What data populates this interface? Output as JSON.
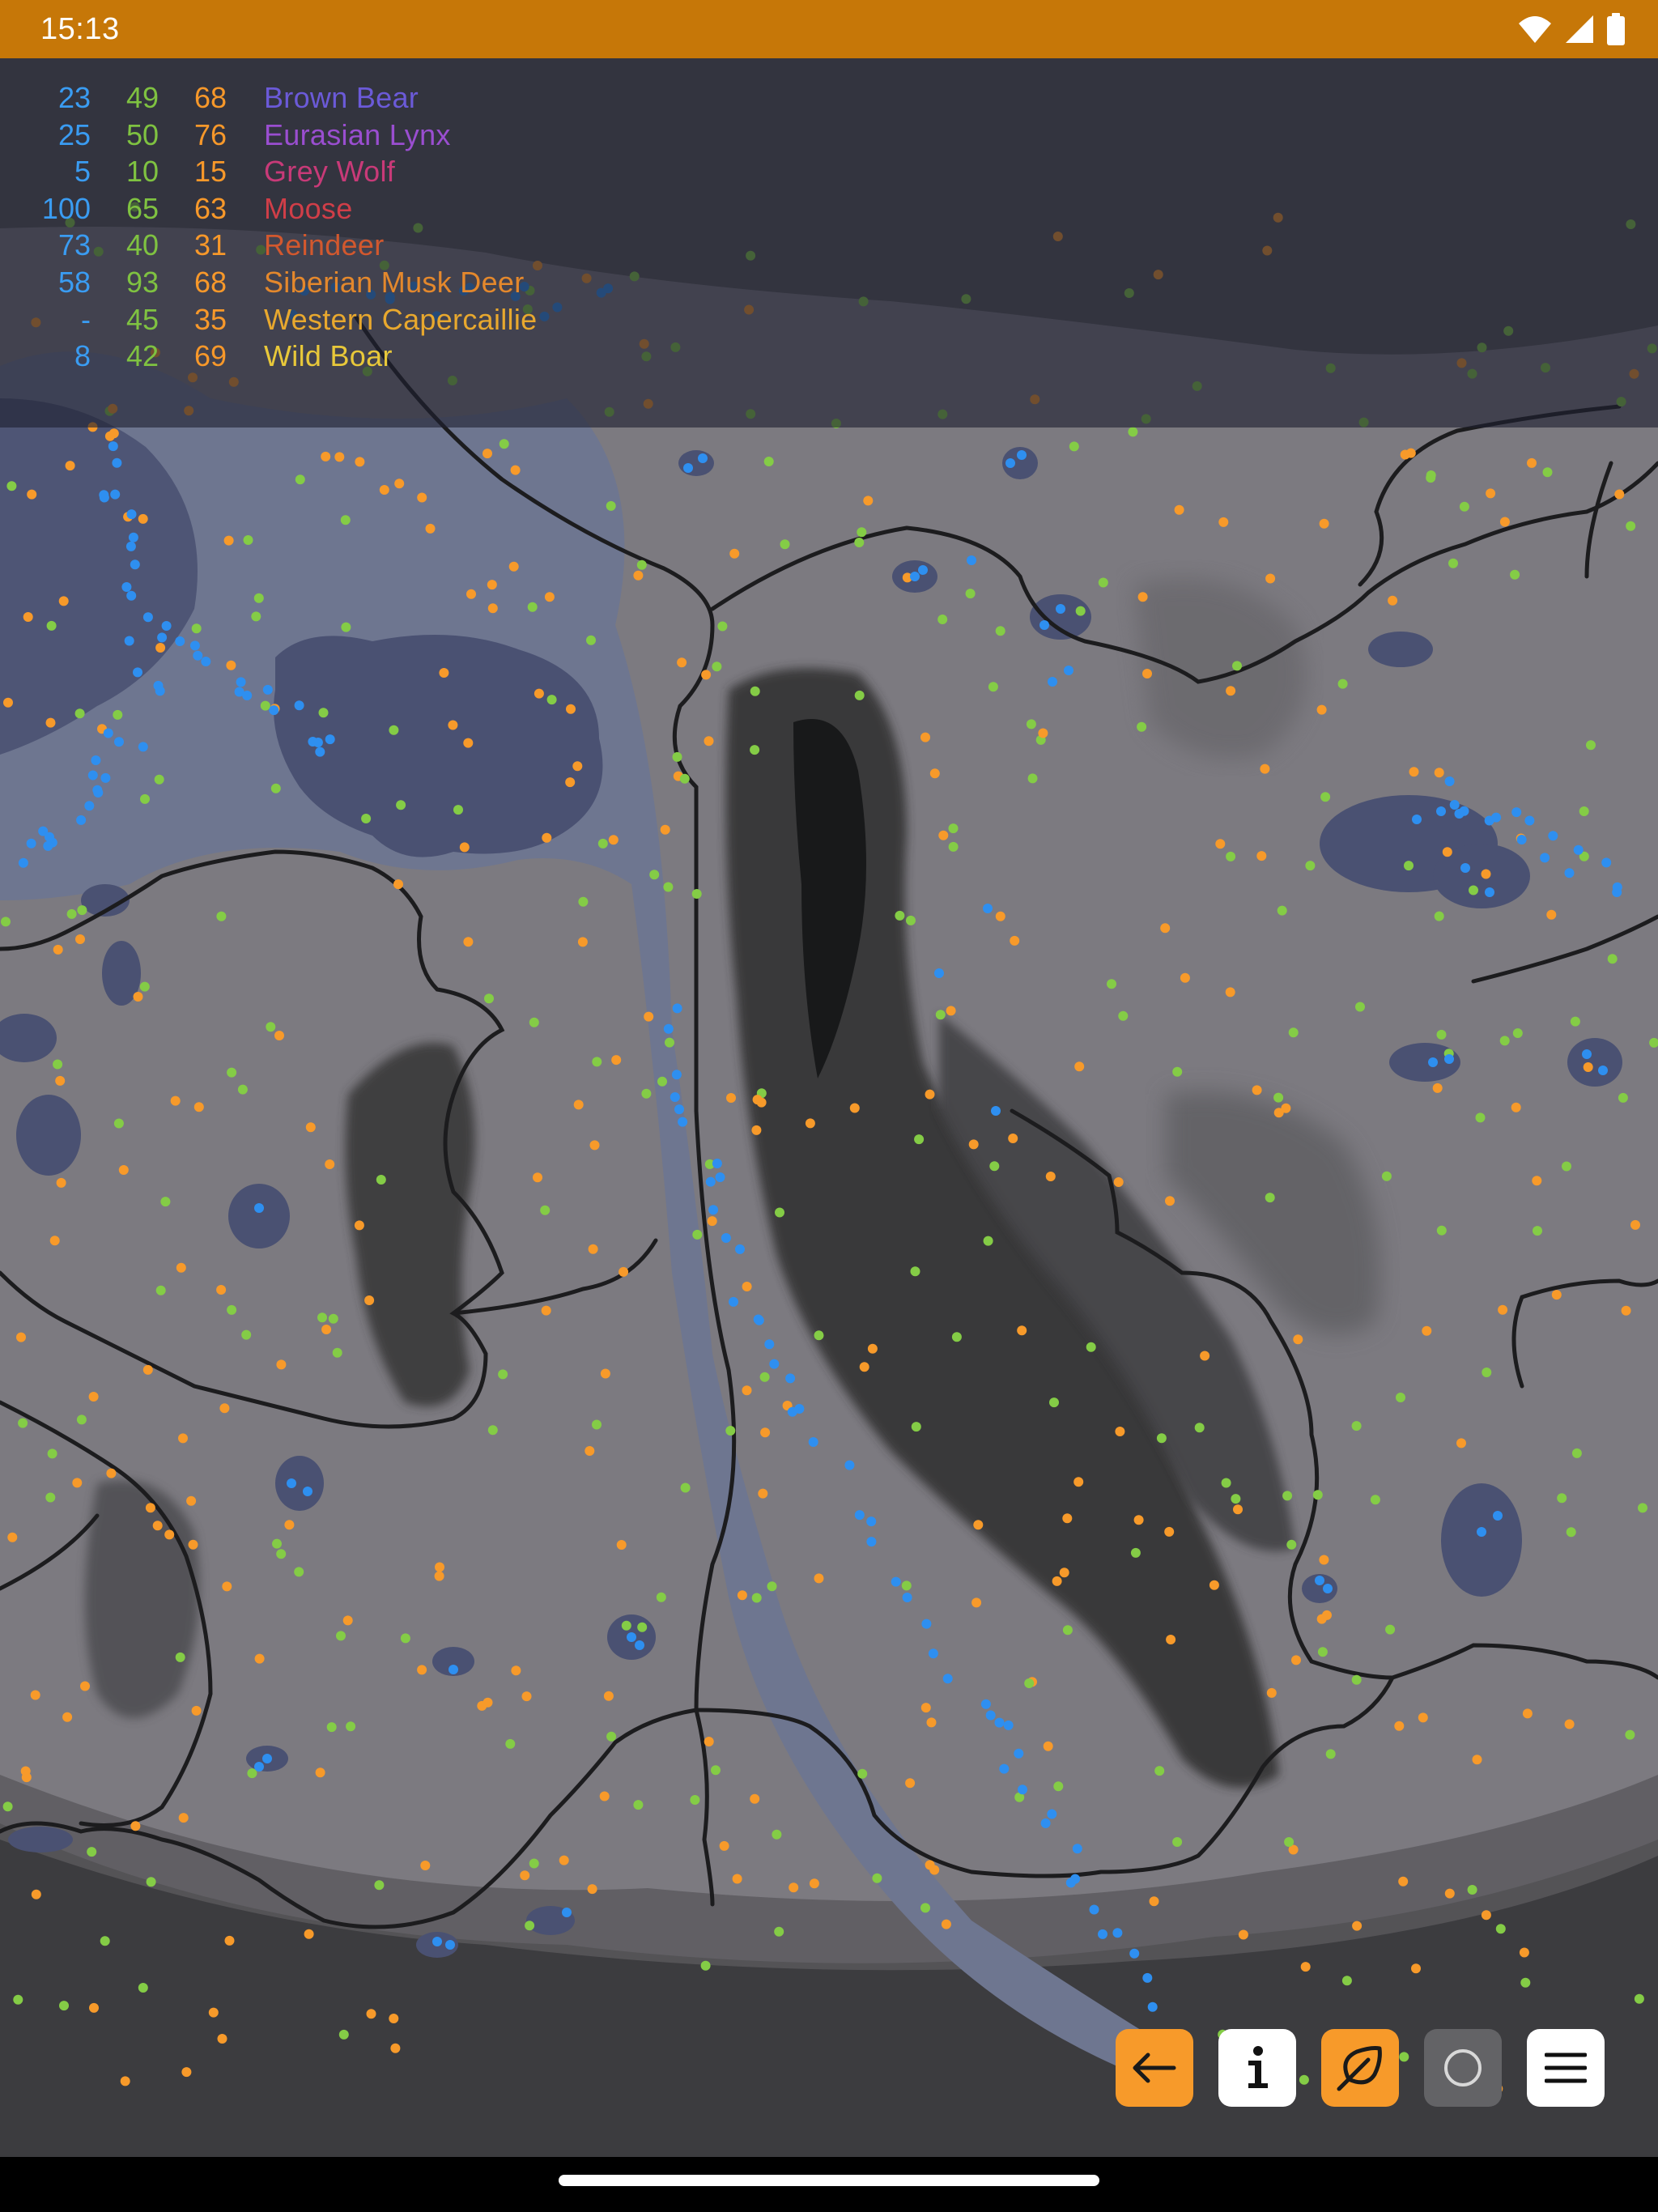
{
  "status_bar": {
    "time": "15:13",
    "bg": "#c67708"
  },
  "legend": {
    "col_colors": [
      "#3a9cf2",
      "#7fc241",
      "#f7982a"
    ],
    "rows": [
      {
        "a": "23",
        "b": "49",
        "c": "68",
        "name": "Brown Bear",
        "color": "#6b5ad8"
      },
      {
        "a": "25",
        "b": "50",
        "c": "76",
        "name": "Eurasian Lynx",
        "color": "#9a4ed0"
      },
      {
        "a": "5",
        "b": "10",
        "c": "15",
        "name": "Grey Wolf",
        "color": "#c83a78"
      },
      {
        "a": "100",
        "b": "65",
        "c": "63",
        "name": "Moose",
        "color": "#d03e48"
      },
      {
        "a": "73",
        "b": "40",
        "c": "31",
        "name": "Reindeer",
        "color": "#d2582e"
      },
      {
        "a": "58",
        "b": "93",
        "c": "68",
        "name": "Siberian Musk Deer",
        "color": "#e4882c"
      },
      {
        "a": "-",
        "b": "45",
        "c": "35",
        "name": "Western Capercaillie",
        "color": "#e8a82e"
      },
      {
        "a": "8",
        "b": "42",
        "c": "69",
        "name": "Wild Boar",
        "color": "#e8c83a"
      }
    ]
  },
  "map": {
    "land": "#7d7b82",
    "water": "#4b5272",
    "shallow": "#707894",
    "dark_terrain": "#2a2b2c",
    "border": "#1c1c1e",
    "dot_colors": {
      "blue": "#2e8ff0",
      "green": "#84cc46",
      "orange": "#f79a2a"
    }
  },
  "toolbar": {
    "back": {
      "icon": "arrow-left-icon",
      "bg": "#f79a2a"
    },
    "info": {
      "icon": "info-icon",
      "bg": "#ffffff"
    },
    "leaf": {
      "icon": "leaf-icon",
      "bg": "#f79a2a"
    },
    "circle": {
      "icon": "circle-icon",
      "bg": "#636366"
    },
    "menu": {
      "icon": "menu-icon",
      "bg": "#ffffff"
    }
  }
}
